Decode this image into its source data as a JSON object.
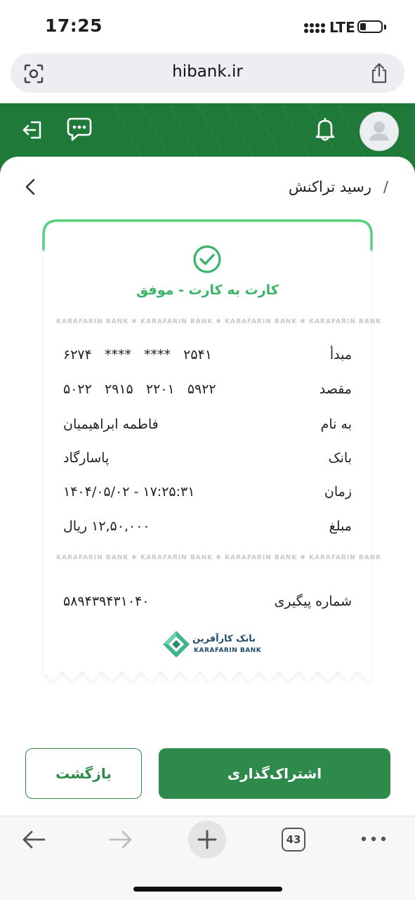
{
  "status_bar": {
    "time": "17:25",
    "network": "LTE",
    "signal_icon": "signal-icon",
    "battery_icon": "battery-icon"
  },
  "browser": {
    "url": "hibank.ir",
    "tabs_count": "43"
  },
  "header": {
    "bg_color": "#1f7a3a"
  },
  "page": {
    "breadcrumb_sep": "/",
    "breadcrumb": "رسید تراکنش"
  },
  "receipt": {
    "status_title": "کارت به کارت - موفق",
    "status_color": "#3bb36a",
    "watermark": "KARAFARIN BANK ✱ KARAFARIN BANK ✱ KARAFARIN BANK ✱ KARAFARIN BANK",
    "rows": [
      {
        "label": "مبدأ",
        "value": "۶۲۷۴   ****   ****   ۲۵۴۱"
      },
      {
        "label": "مقصد",
        "value": "۵۰۲۲   ۲۹۱۵   ۲۲۰۱   ۵۹۲۲"
      },
      {
        "label": "به نام",
        "value": "فاطمه ابراهیمیان"
      },
      {
        "label": "بانک",
        "value": "پاسارگاد"
      },
      {
        "label": "زمان",
        "value": "۱۴۰۴/۰۵/۰۲ - ۱۷:۲۵:۳۱"
      },
      {
        "label": "مبلغ",
        "value": "۱۲,۵۰,۰۰۰ ریال"
      }
    ],
    "tracking": {
      "label": "شماره پیگیری",
      "value": "۵۸۹۴۳۹۴۳۱۰۴۰"
    },
    "logo": {
      "fa": "بانک کارآفرین",
      "en": "KARAFARIN BANK"
    }
  },
  "actions": {
    "back": "بازگشت",
    "share": "اشتراک‌گذاری",
    "primary_color": "#2e8a4a"
  }
}
